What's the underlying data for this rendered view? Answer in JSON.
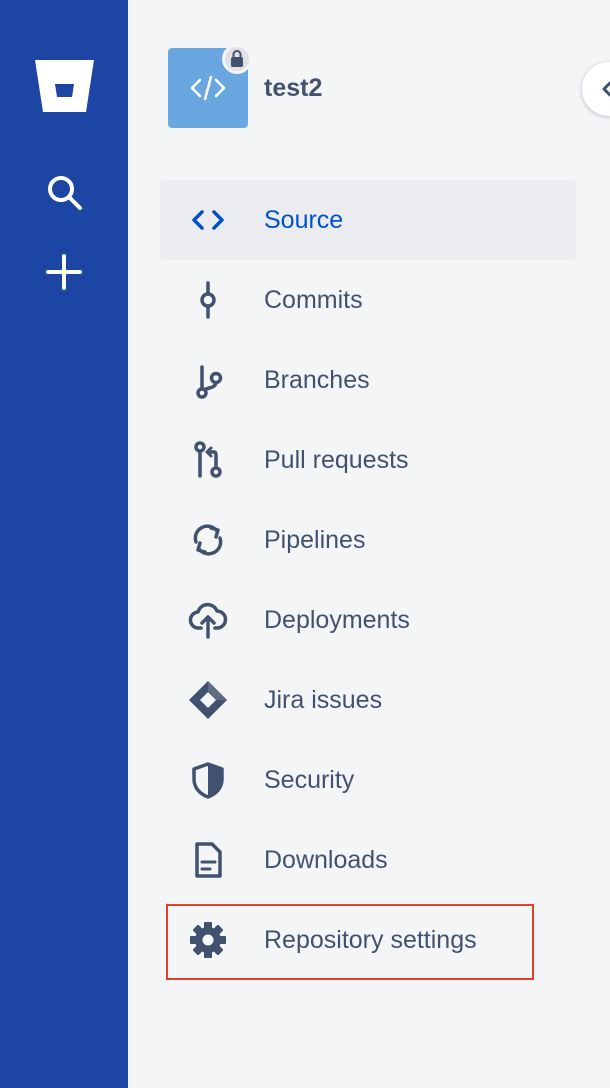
{
  "colors": {
    "global_nav_bg": "#1d45a3",
    "sidebar_bg": "#f4f5f7",
    "active_item_bg": "#ebecf0",
    "active_text": "#0052cc",
    "text": "#42526e",
    "avatar_bg": "#6aa6e0",
    "highlight": "#e2402a"
  },
  "global_nav": {
    "logo_icon": "bitbucket-logo-icon",
    "search_icon": "search-icon",
    "create_icon": "plus-icon"
  },
  "repo": {
    "name": "test2",
    "avatar_icon": "code-icon",
    "private_badge_icon": "lock-icon"
  },
  "nav_items": [
    {
      "label": "Source",
      "icon": "code-icon",
      "active": true
    },
    {
      "label": "Commits",
      "icon": "commit-icon",
      "active": false
    },
    {
      "label": "Branches",
      "icon": "branch-icon",
      "active": false
    },
    {
      "label": "Pull requests",
      "icon": "pull-request-icon",
      "active": false
    },
    {
      "label": "Pipelines",
      "icon": "refresh-icon",
      "active": false
    },
    {
      "label": "Deployments",
      "icon": "cloud-upload-icon",
      "active": false
    },
    {
      "label": "Jira issues",
      "icon": "jira-icon",
      "active": false
    },
    {
      "label": "Security",
      "icon": "shield-icon",
      "active": false
    },
    {
      "label": "Downloads",
      "icon": "document-icon",
      "active": false
    },
    {
      "label": "Repository settings",
      "icon": "gear-icon",
      "active": false,
      "highlighted": true
    }
  ],
  "collapse_button": {
    "icon": "chevron-left-icon"
  }
}
